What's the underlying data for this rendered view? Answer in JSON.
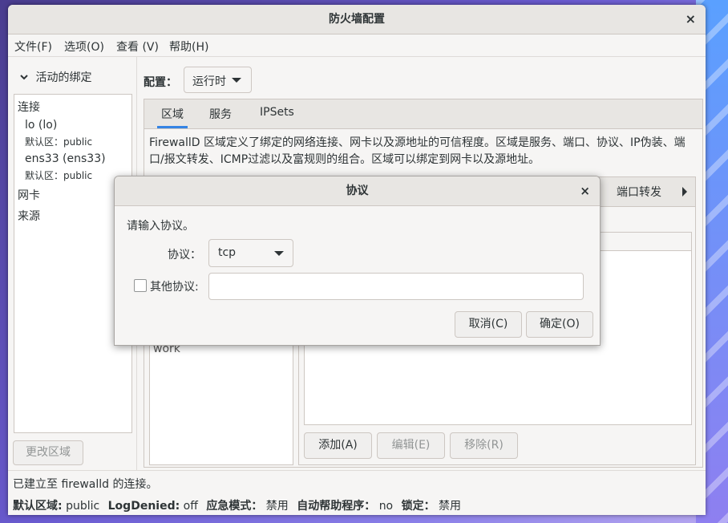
{
  "window": {
    "title": "防火墙配置",
    "close_glyph": "×"
  },
  "menu": [
    "文件(F)",
    "选项(O)",
    "查看 (V)",
    "帮助(H)"
  ],
  "left": {
    "header": "活动的绑定",
    "sections": {
      "connections": "连接",
      "interfaces": "网卡",
      "sources": "来源"
    },
    "connections": [
      {
        "name": "lo (lo)",
        "zone": "默认区：public"
      },
      {
        "name": "ens33 (ens33)",
        "zone": "默认区：public"
      }
    ],
    "change_zone_button": "更改区域"
  },
  "config": {
    "label": "配置：",
    "value": "运行时"
  },
  "tabs": [
    "区域",
    "服务",
    "IPSets"
  ],
  "description": "FirewallD 区域定义了绑定的网络连接、网卡以及源地址的可信程度。区域是服务、端口、协议、IP伪装、端口/报文转发、ICMP过滤以及富规则的组合。区域可以绑定到网卡以及源地址。",
  "zone_list": {
    "visible_item": "work"
  },
  "zone_tabs": {
    "visible_tab": "端口转发"
  },
  "buttons": {
    "add": "添加(A)",
    "edit": "编辑(E)",
    "remove": "移除(R)"
  },
  "status": {
    "connection": "已建立至 firewalld 的连接。",
    "default_zone_label": "默认区域:",
    "default_zone_value": "public",
    "logdenied_label": "LogDenied:",
    "logdenied_value": "off",
    "panic_label": "应急模式：",
    "panic_value": "禁用",
    "autohelper_label": "自动帮助程序：",
    "autohelper_value": "no",
    "lockdown_label": "锁定：",
    "lockdown_value": "禁用"
  },
  "dialog": {
    "title": "协议",
    "close_glyph": "×",
    "prompt": "请输入协议。",
    "protocol_label": "协议：",
    "protocol_value": "tcp",
    "other_label": "其他协议:",
    "other_value": "",
    "cancel": "取消(C)",
    "ok": "确定(O)"
  }
}
